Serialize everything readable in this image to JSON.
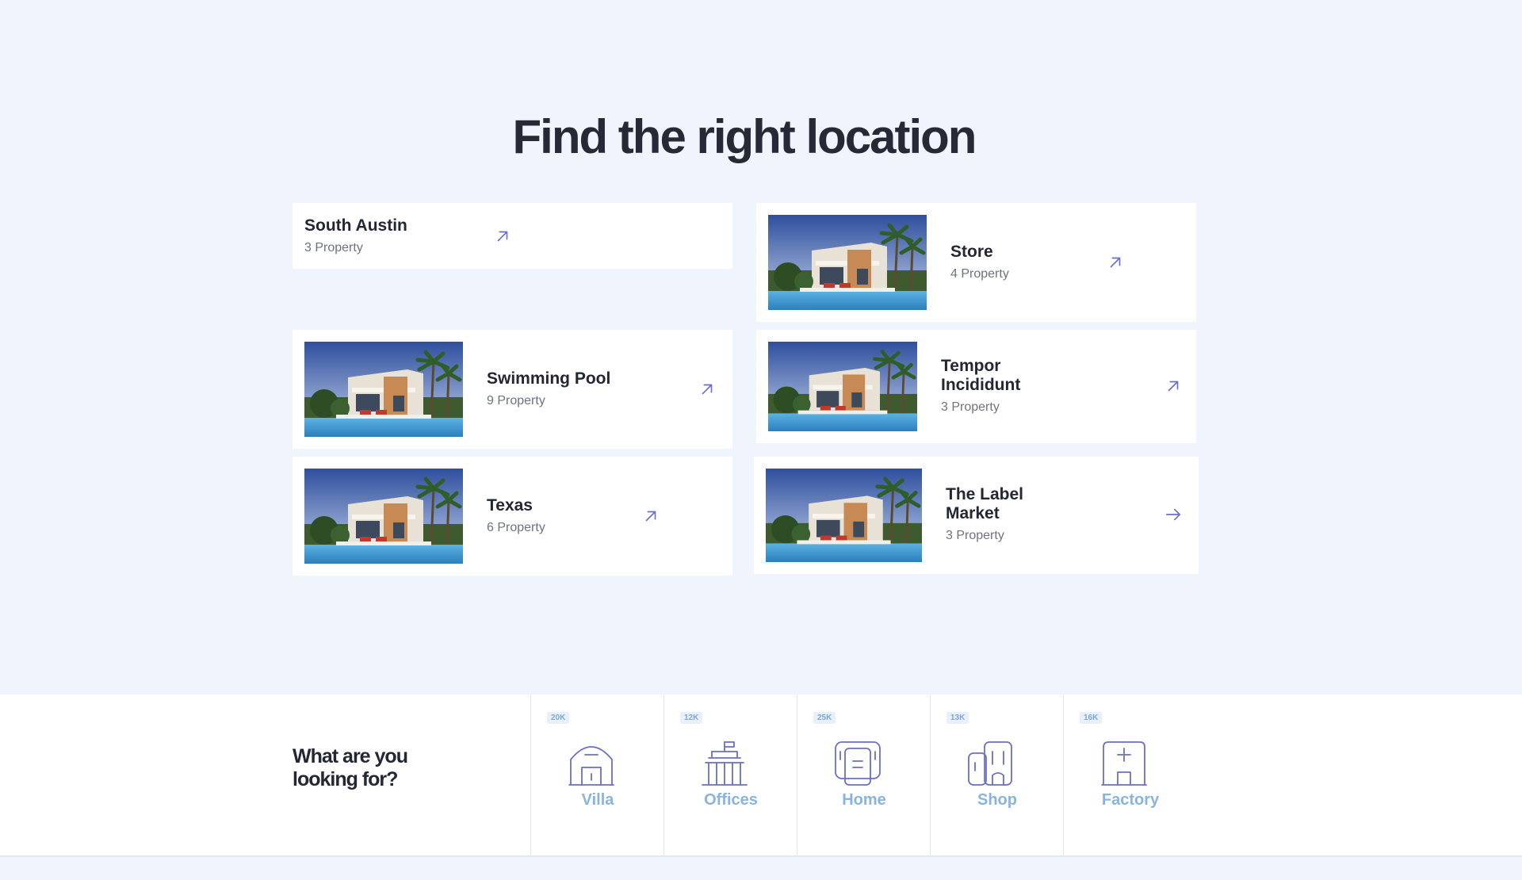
{
  "heading": "Find the right location",
  "locations": [
    {
      "title": "South Austin",
      "count": "3 Property",
      "has_image": false,
      "arrow": "arrow-up-right-icon"
    },
    {
      "title": "Store",
      "count": "4 Property",
      "has_image": true,
      "arrow": "arrow-up-right-icon"
    },
    {
      "title": "Swimming Pool",
      "count": "9 Property",
      "has_image": true,
      "arrow": "arrow-up-right-icon"
    },
    {
      "title": "Tempor Incididunt",
      "count": "3 Property",
      "has_image": true,
      "arrow": "arrow-up-right-icon"
    },
    {
      "title": "Texas",
      "count": "6 Property",
      "has_image": true,
      "arrow": "arrow-up-right-icon"
    },
    {
      "title": "The Label Market",
      "count": "3 Property",
      "has_image": true,
      "arrow": "arrow-right-icon"
    }
  ],
  "categories_section": {
    "title": "What are you looking for?",
    "items": [
      {
        "label": "Villa",
        "count": "20K",
        "icon": "villa-icon"
      },
      {
        "label": "Offices",
        "count": "12K",
        "icon": "office-building-icon"
      },
      {
        "label": "Home",
        "count": "25K",
        "icon": "home-icon"
      },
      {
        "label": "Shop",
        "count": "13K",
        "icon": "shop-icon"
      },
      {
        "label": "Factory",
        "count": "16K",
        "icon": "factory-icon"
      }
    ]
  },
  "colors": {
    "background": "#f0f4fd",
    "accent": "#6b6fc7",
    "category_label": "#8ab4dc",
    "heading": "#262a36"
  }
}
